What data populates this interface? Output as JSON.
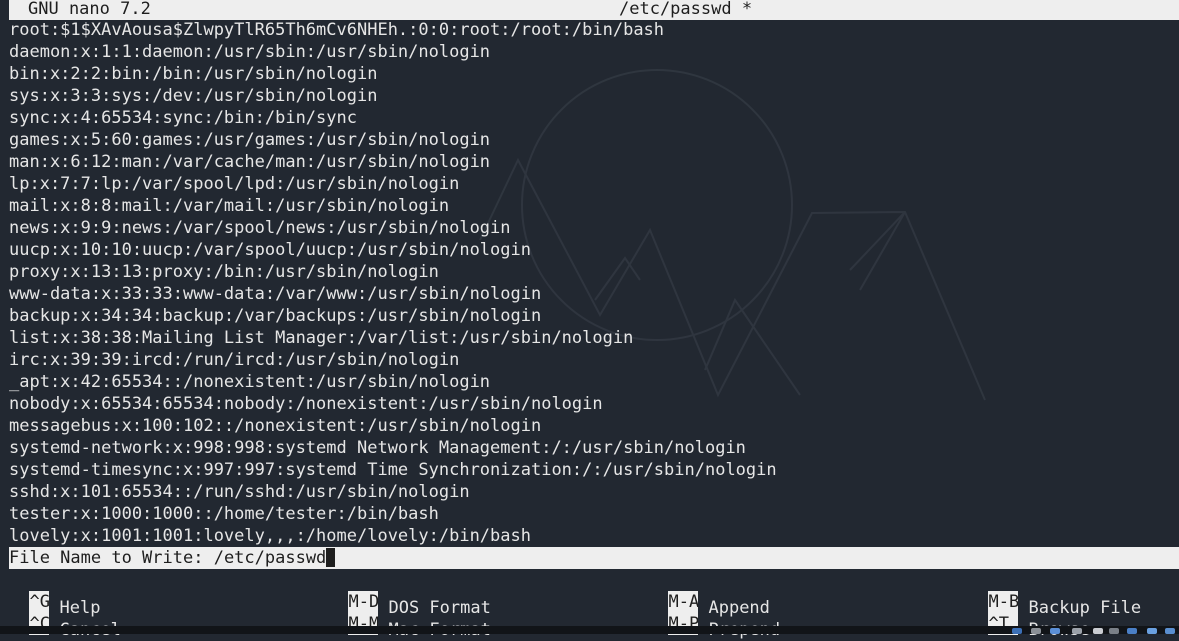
{
  "header": {
    "app_version": "GNU nano 7.2",
    "file_title": "/etc/passwd *"
  },
  "file_lines": [
    "root:$1$XAvAousa$ZlwpyTlR65Th6mCv6NHEh.:0:0:root:/root:/bin/bash",
    "daemon:x:1:1:daemon:/usr/sbin:/usr/sbin/nologin",
    "bin:x:2:2:bin:/bin:/usr/sbin/nologin",
    "sys:x:3:3:sys:/dev:/usr/sbin/nologin",
    "sync:x:4:65534:sync:/bin:/bin/sync",
    "games:x:5:60:games:/usr/games:/usr/sbin/nologin",
    "man:x:6:12:man:/var/cache/man:/usr/sbin/nologin",
    "lp:x:7:7:lp:/var/spool/lpd:/usr/sbin/nologin",
    "mail:x:8:8:mail:/var/mail:/usr/sbin/nologin",
    "news:x:9:9:news:/var/spool/news:/usr/sbin/nologin",
    "uucp:x:10:10:uucp:/var/spool/uucp:/usr/sbin/nologin",
    "proxy:x:13:13:proxy:/bin:/usr/sbin/nologin",
    "www-data:x:33:33:www-data:/var/www:/usr/sbin/nologin",
    "backup:x:34:34:backup:/var/backups:/usr/sbin/nologin",
    "list:x:38:38:Mailing List Manager:/var/list:/usr/sbin/nologin",
    "irc:x:39:39:ircd:/run/ircd:/usr/sbin/nologin",
    "_apt:x:42:65534::/nonexistent:/usr/sbin/nologin",
    "nobody:x:65534:65534:nobody:/nonexistent:/usr/sbin/nologin",
    "messagebus:x:100:102::/nonexistent:/usr/sbin/nologin",
    "systemd-network:x:998:998:systemd Network Management:/:/usr/sbin/nologin",
    "systemd-timesync:x:997:997:systemd Time Synchronization:/:/usr/sbin/nologin",
    "sshd:x:101:65534::/run/sshd:/usr/sbin/nologin",
    "tester:x:1000:1000::/home/tester:/bin/bash",
    "lovely:x:1001:1001:lovely,,,:/home/lovely:/bin/bash"
  ],
  "prompt": {
    "label": "File Name to Write: ",
    "value": "/etc/passwd"
  },
  "shortcuts": {
    "row1": [
      {
        "key": "^G",
        "label": "Help"
      },
      {
        "key": "M-D",
        "label": "DOS Format"
      },
      {
        "key": "M-A",
        "label": "Append"
      },
      {
        "key": "M-B",
        "label": "Backup File"
      }
    ],
    "row2": [
      {
        "key": "^C",
        "label": "Cancel"
      },
      {
        "key": "M-M",
        "label": "Mac Format"
      },
      {
        "key": "M-P",
        "label": "Prepend"
      },
      {
        "key": "^T",
        "label": "Browse"
      }
    ]
  },
  "colors": {
    "background": "#222831",
    "bar": "#eeeeee",
    "text": "#e6e6e6"
  }
}
